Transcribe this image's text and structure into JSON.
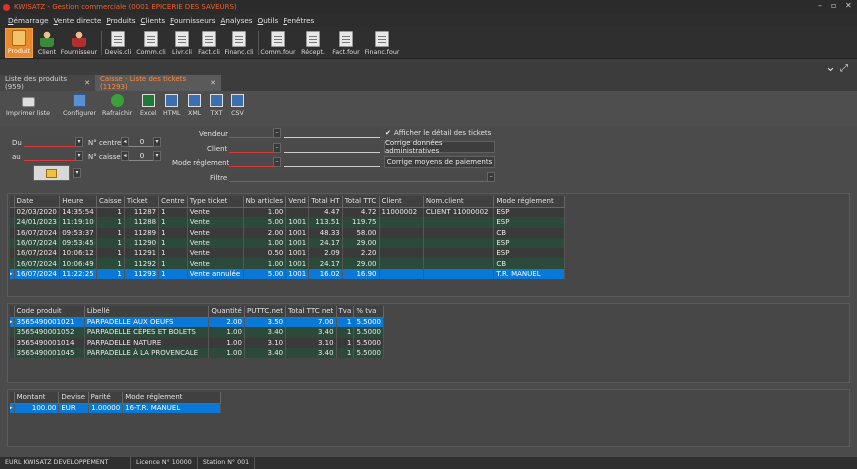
{
  "window": {
    "title": "KWISATZ - Gestion commerciale (0001 EPICERIE DES SAVEURS)",
    "controls": [
      "–",
      "▫",
      "✕"
    ]
  },
  "menu": [
    "Démarrage",
    "Vente directe",
    "Produits",
    "Clients",
    "Fournisseurs",
    "Analyses",
    "Outils",
    "Fenêtres"
  ],
  "ribbon": [
    {
      "label": "Produit",
      "icon": "product-box-icon",
      "active": true
    },
    {
      "label": "Client",
      "icon": "client-person-icon"
    },
    {
      "label": "Fournisseur",
      "icon": "supplier-person-icon"
    },
    {
      "label": "Devis.cli",
      "icon": "document-icon"
    },
    {
      "label": "Comm.cli",
      "icon": "document-icon"
    },
    {
      "label": "Livr.cli",
      "icon": "document-icon"
    },
    {
      "label": "Fact.cli",
      "icon": "document-icon"
    },
    {
      "label": "Financ.cli",
      "icon": "document-icon"
    },
    {
      "label": "Comm.four",
      "icon": "document-icon"
    },
    {
      "label": "Récept.",
      "icon": "document-icon"
    },
    {
      "label": "Fact.four",
      "icon": "document-icon"
    },
    {
      "label": "Financ.four",
      "icon": "document-icon"
    }
  ],
  "tabs": [
    {
      "label": "Liste des produits (959)"
    },
    {
      "label": "Caisse - Liste des tickets (11293)",
      "active": true
    }
  ],
  "toolbar": [
    "Imprimer liste",
    "Configurer",
    "Rafraichir",
    "Excel",
    "HTML",
    "XML",
    "TXT",
    "CSV"
  ],
  "filters": {
    "du_label": "Du",
    "au_label": "au",
    "centre_label": "N° centre",
    "centre_value": "0",
    "caisse_label": "N° caisse",
    "caisse_value": "0",
    "vendeur_label": "Vendeur",
    "client_label": "Client",
    "mode_label": "Mode réglement",
    "filtre_label": "Filtre",
    "detail_checkbox": "Afficher le détail des tickets",
    "btn_admin": "Corrige données administratives",
    "btn_payment": "Corrige moyens de paiements"
  },
  "tickets": {
    "columns": [
      "Date",
      "Heure",
      "Caisse",
      "Ticket",
      "Centre",
      "Type ticket",
      "Nb articles",
      "Vend",
      "Total HT",
      "Total TTC",
      "Client",
      "Nom.client",
      "Mode réglement"
    ],
    "rows": [
      [
        "02/03/2020",
        "14:35:54",
        "1",
        "11287",
        "1",
        "Vente",
        "1.00",
        "",
        "4.47",
        "4.72",
        "11000002",
        "CLIENT  11000002",
        "ESP"
      ],
      [
        "24/01/2023",
        "11:19:10",
        "1",
        "11288",
        "1",
        "Vente",
        "5.00",
        "1001",
        "113.51",
        "119.75",
        "",
        "",
        "ESP"
      ],
      [
        "16/07/2024",
        "09:53:37",
        "1",
        "11289",
        "1",
        "Vente",
        "2.00",
        "1001",
        "48.33",
        "58.00",
        "",
        "",
        "CB"
      ],
      [
        "16/07/2024",
        "09:53:45",
        "1",
        "11290",
        "1",
        "Vente",
        "1.00",
        "1001",
        "24.17",
        "29.00",
        "",
        "",
        "ESP"
      ],
      [
        "16/07/2024",
        "10:06:12",
        "1",
        "11291",
        "1",
        "Vente",
        "0.50",
        "1001",
        "2.09",
        "2.20",
        "",
        "",
        "ESP"
      ],
      [
        "16/07/2024",
        "10:06:49",
        "1",
        "11292",
        "1",
        "Vente",
        "1.00",
        "1001",
        "24.17",
        "29.00",
        "",
        "",
        "CB"
      ],
      [
        "16/07/2024",
        "11:22:25",
        "1",
        "11293",
        "1",
        "Vente annulée",
        "5.00",
        "1001",
        "16.02",
        "16.90",
        "",
        "",
        "T.R. MANUEL"
      ]
    ]
  },
  "lines": {
    "columns": [
      "Code produit",
      "Libellé",
      "Quantité",
      "PUTTC.net",
      "Total TTC net",
      "Tva",
      "% tva"
    ],
    "rows": [
      [
        "3565490001021",
        "PARPADELLE AUX OEUFS",
        "2.00",
        "3.50",
        "7.00",
        "1",
        "5.5000"
      ],
      [
        "3565490001052",
        "PARPADELLE CÈPES ET BOLETS",
        "1.00",
        "3.40",
        "3.40",
        "1",
        "5.5000"
      ],
      [
        "3565490001014",
        "PARPADELLE NATURE",
        "1.00",
        "3.10",
        "3.10",
        "1",
        "5.5000"
      ],
      [
        "3565490001045",
        "PARPADELLE À LA PROVENCALE",
        "1.00",
        "3.40",
        "3.40",
        "1",
        "5.5000"
      ]
    ]
  },
  "payments": {
    "columns": [
      "Montant",
      "Devise",
      "Parité",
      "Mode réglement"
    ],
    "rows": [
      [
        "100.00",
        "EUR",
        "1.00000",
        "16-T.R. MANUEL"
      ]
    ]
  },
  "status": [
    "EURL KWISATZ DEVELOPPEMENT",
    "Licence N° 10000",
    "Station N° 001"
  ],
  "colors": {
    "accent": "#e8892a",
    "selection": "#0a78d7",
    "row_alt": "#2c4a3a"
  }
}
